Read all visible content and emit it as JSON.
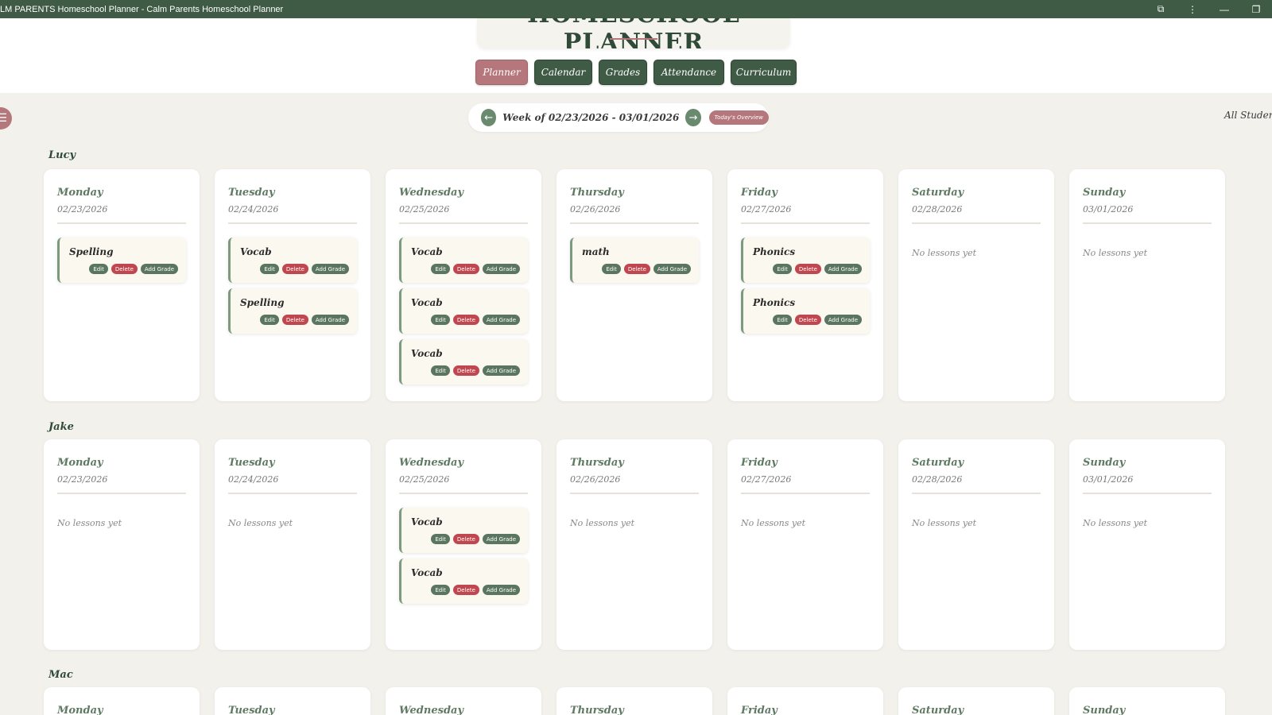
{
  "window": {
    "title": "LM PARENTS Homeschool Planner - Calm Parents Homeschool Planner",
    "controls": [
      "extensions-icon",
      "more-icon",
      "minimize-icon",
      "restore-icon"
    ]
  },
  "header": {
    "logo_text": "HOMESCHOOL PLANNER",
    "nav": [
      {
        "label": "Planner",
        "active": true
      },
      {
        "label": "Calendar",
        "active": false
      },
      {
        "label": "Grades",
        "active": false
      },
      {
        "label": "Attendance",
        "active": false
      },
      {
        "label": "Curriculum",
        "active": false
      }
    ]
  },
  "week": {
    "prev_icon": "←",
    "label": "Week of 02/23/2026 - 03/01/2026",
    "next_icon": "→",
    "today_button": "Today's Overview"
  },
  "filter": {
    "label": "All Studen"
  },
  "lesson_actions": {
    "edit": "Edit",
    "delete": "Delete",
    "add_grade": "Add Grade"
  },
  "empty_text": "No lessons yet",
  "students": [
    {
      "name": "Lucy",
      "days": [
        {
          "day": "Monday",
          "date": "02/23/2026",
          "lessons": [
            "Spelling"
          ]
        },
        {
          "day": "Tuesday",
          "date": "02/24/2026",
          "lessons": [
            "Vocab",
            "Spelling"
          ]
        },
        {
          "day": "Wednesday",
          "date": "02/25/2026",
          "lessons": [
            "Vocab",
            "Vocab",
            "Vocab"
          ]
        },
        {
          "day": "Thursday",
          "date": "02/26/2026",
          "lessons": [
            "math"
          ]
        },
        {
          "day": "Friday",
          "date": "02/27/2026",
          "lessons": [
            "Phonics",
            "Phonics"
          ]
        },
        {
          "day": "Saturday",
          "date": "02/28/2026",
          "lessons": []
        },
        {
          "day": "Sunday",
          "date": "03/01/2026",
          "lessons": []
        }
      ]
    },
    {
      "name": "Jake",
      "days": [
        {
          "day": "Monday",
          "date": "02/23/2026",
          "lessons": []
        },
        {
          "day": "Tuesday",
          "date": "02/24/2026",
          "lessons": []
        },
        {
          "day": "Wednesday",
          "date": "02/25/2026",
          "lessons": [
            "Vocab",
            "Vocab"
          ]
        },
        {
          "day": "Thursday",
          "date": "02/26/2026",
          "lessons": []
        },
        {
          "day": "Friday",
          "date": "02/27/2026",
          "lessons": []
        },
        {
          "day": "Saturday",
          "date": "02/28/2026",
          "lessons": []
        },
        {
          "day": "Sunday",
          "date": "03/01/2026",
          "lessons": []
        }
      ]
    },
    {
      "name": "Mac",
      "days": [
        {
          "day": "Monday"
        },
        {
          "day": "Tuesday"
        },
        {
          "day": "Wednesday"
        },
        {
          "day": "Thursday"
        },
        {
          "day": "Friday"
        },
        {
          "day": "Saturday"
        },
        {
          "day": "Sunday"
        }
      ]
    }
  ]
}
